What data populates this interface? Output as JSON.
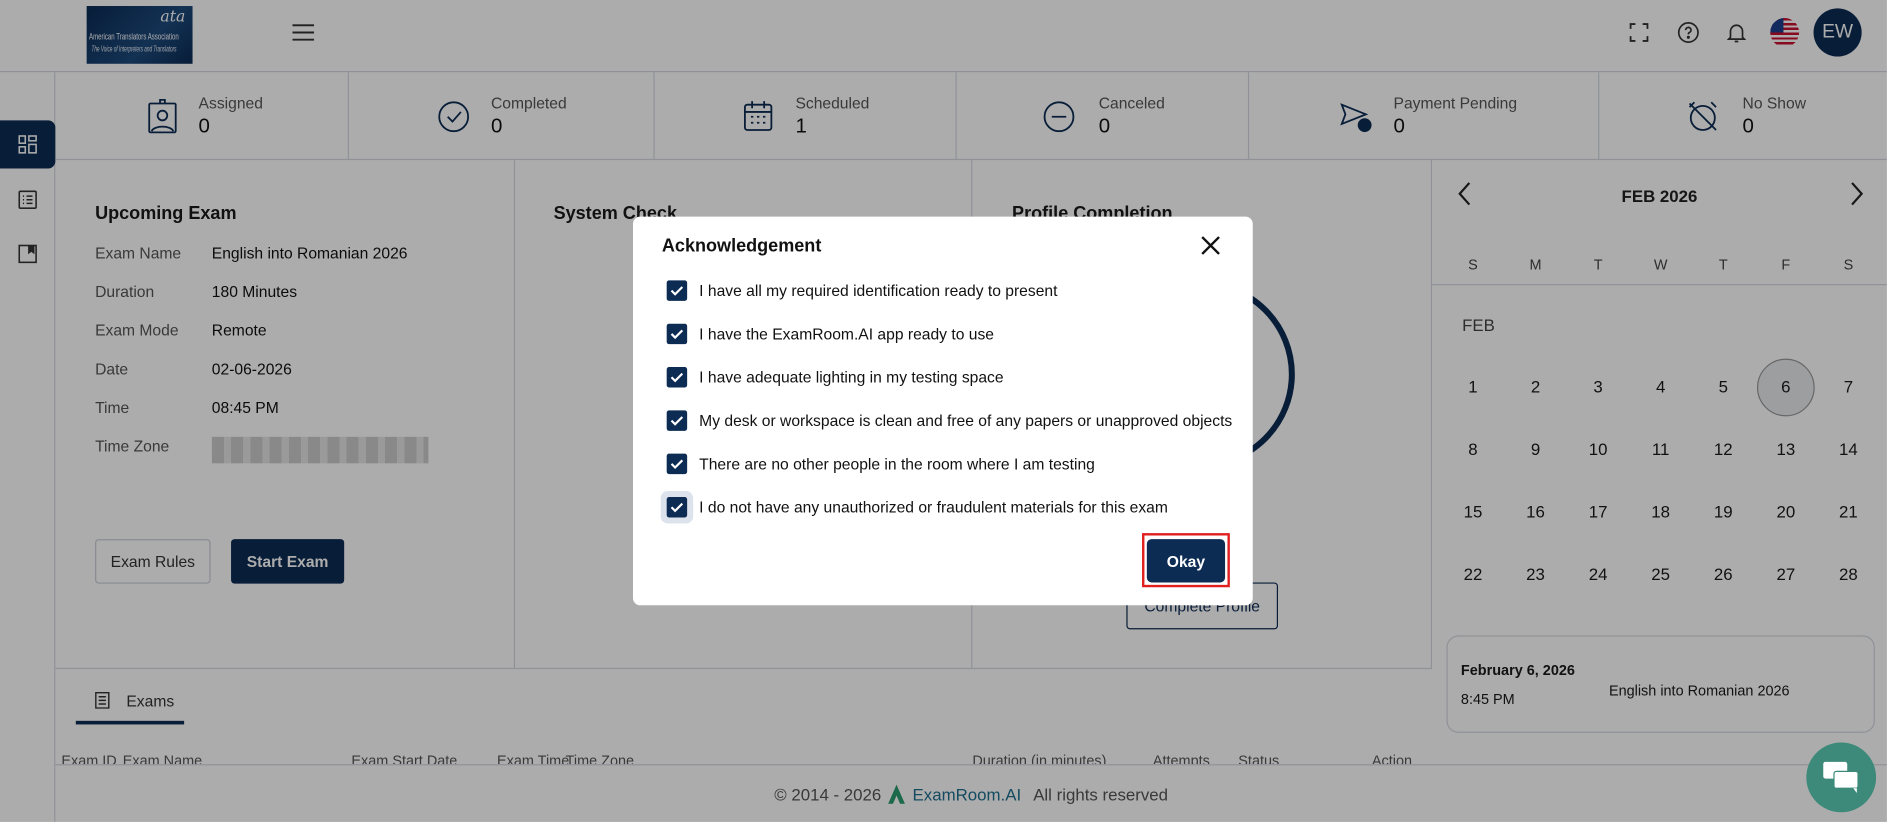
{
  "header": {
    "logo": {
      "mark": "ata",
      "name": "American Translators Association",
      "tagline": "The Voice of Interpreters and Translators"
    },
    "avatar_initials": "EW"
  },
  "stats": [
    {
      "label": "Assigned",
      "value": "0",
      "icon": "badge-icon"
    },
    {
      "label": "Completed",
      "value": "0",
      "icon": "check-circle-icon"
    },
    {
      "label": "Scheduled",
      "value": "1",
      "icon": "calendar-icon"
    },
    {
      "label": "Canceled",
      "value": "0",
      "icon": "minus-circle-icon"
    },
    {
      "label": "Payment Pending",
      "value": "0",
      "icon": "payment-pending-icon"
    },
    {
      "label": "No Show",
      "value": "0",
      "icon": "alarm-off-icon"
    }
  ],
  "upcoming": {
    "title": "Upcoming Exam",
    "rows": [
      {
        "k": "Exam Name",
        "v": "English into Romanian 2026"
      },
      {
        "k": "Duration",
        "v": "180 Minutes"
      },
      {
        "k": "Exam Mode",
        "v": "Remote"
      },
      {
        "k": "Date",
        "v": "02-06-2026"
      },
      {
        "k": "Time",
        "v": "08:45 PM"
      },
      {
        "k": "Time Zone",
        "v": ""
      }
    ],
    "rules_label": "Exam Rules",
    "start_label": "Start Exam"
  },
  "system_check": {
    "title": "System Check"
  },
  "profile": {
    "title": "Profile Completion",
    "button": "Complete Profile"
  },
  "calendar": {
    "month_label": "FEB 2026",
    "weekdays": [
      "S",
      "M",
      "T",
      "W",
      "T",
      "F",
      "S"
    ],
    "month_short": "FEB",
    "days": [
      "1",
      "2",
      "3",
      "4",
      "5",
      "6",
      "7",
      "8",
      "9",
      "10",
      "11",
      "12",
      "13",
      "14",
      "15",
      "16",
      "17",
      "18",
      "19",
      "20",
      "21",
      "22",
      "23",
      "24",
      "25",
      "26",
      "27",
      "28"
    ],
    "selected_day": "6",
    "event": {
      "date": "February 6, 2026",
      "time": "8:45 PM",
      "name": "English into Romanian 2026"
    }
  },
  "exams": {
    "tab_label": "Exams",
    "columns": [
      "Exam ID",
      "Exam Name",
      "Exam Start Date",
      "Exam Time",
      "Time Zone",
      "Duration (in minutes)",
      "Attempts",
      "Status",
      "Action"
    ]
  },
  "footer": {
    "copyright": "© 2014 - 2026",
    "brand": "ExamRoom.AI",
    "rights": "All rights reserved"
  },
  "modal": {
    "title": "Acknowledgement",
    "items": [
      "I have all my required identification ready to present",
      "I have the ExamRoom.AI app ready to use",
      "I have adequate lighting in my testing space",
      "My desk or workspace is clean and free of any papers or unapproved objects",
      "There are no other people in the room where I am testing",
      "I do not have any unauthorized or fraudulent materials for this exam"
    ],
    "okay_label": "Okay"
  },
  "colors": {
    "primary": "#0d2c54",
    "highlight": "#e02020"
  }
}
